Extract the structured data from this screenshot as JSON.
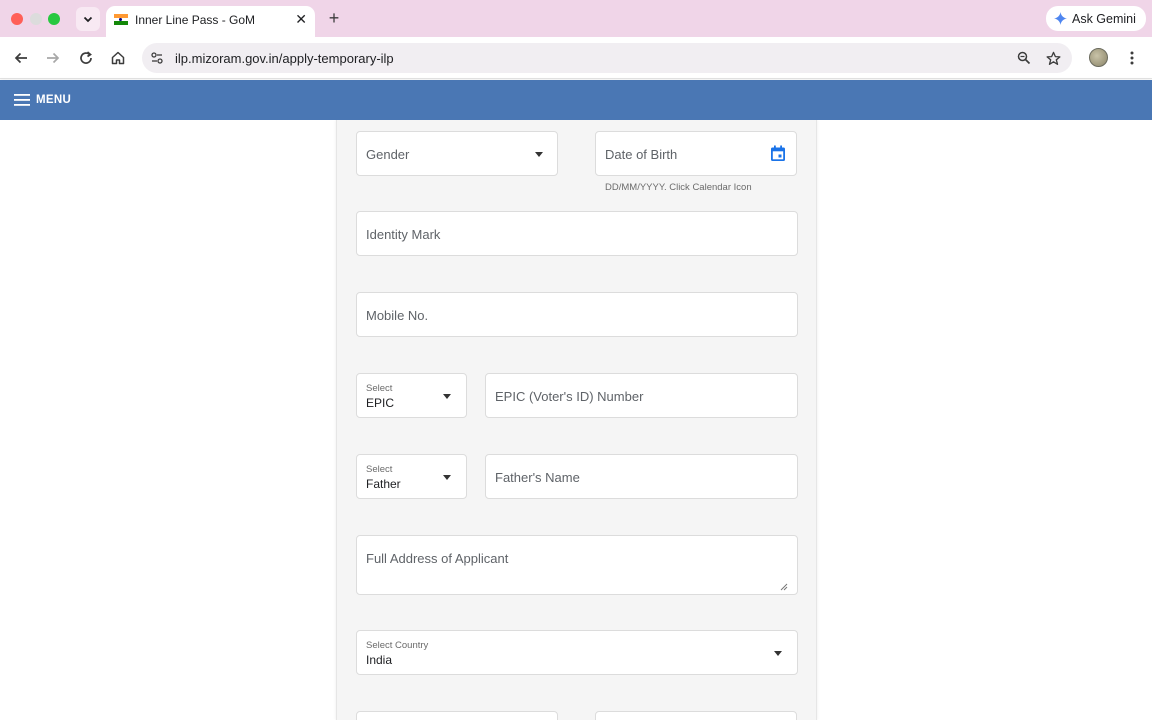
{
  "browser": {
    "tab_title": "Inner Line Pass - GoM",
    "url": "ilp.mizoram.gov.in/apply-temporary-ilp",
    "gemini_label": "Ask Gemini",
    "icons": [
      "chevron-down-icon",
      "india-flag-icon",
      "close-icon",
      "plus-icon",
      "gemini-icon",
      "back-icon",
      "forward-icon",
      "reload-icon",
      "home-icon",
      "site-settings-icon",
      "zoom-icon",
      "bookmark-star-icon",
      "profile-avatar",
      "kebab-menu-icon"
    ]
  },
  "appbar": {
    "menu_label": "MENU",
    "bg": "#4a77b4"
  },
  "form": {
    "gender": {
      "placeholder": "Gender"
    },
    "dob": {
      "placeholder": "Date of Birth",
      "helper": "DD/MM/YYYY. Click Calendar Icon"
    },
    "identity_mark": {
      "placeholder": "Identity Mark"
    },
    "mobile": {
      "placeholder": "Mobile No."
    },
    "id_type": {
      "label": "Select",
      "value": "EPIC"
    },
    "epic_number": {
      "placeholder": "EPIC (Voter's ID) Number"
    },
    "relation": {
      "label": "Select",
      "value": "Father"
    },
    "relative_name": {
      "placeholder": "Father's Name"
    },
    "address": {
      "placeholder": "Full Address of Applicant"
    },
    "country": {
      "label": "Select Country",
      "value": "India"
    }
  },
  "accent_color": "#1a73e8"
}
